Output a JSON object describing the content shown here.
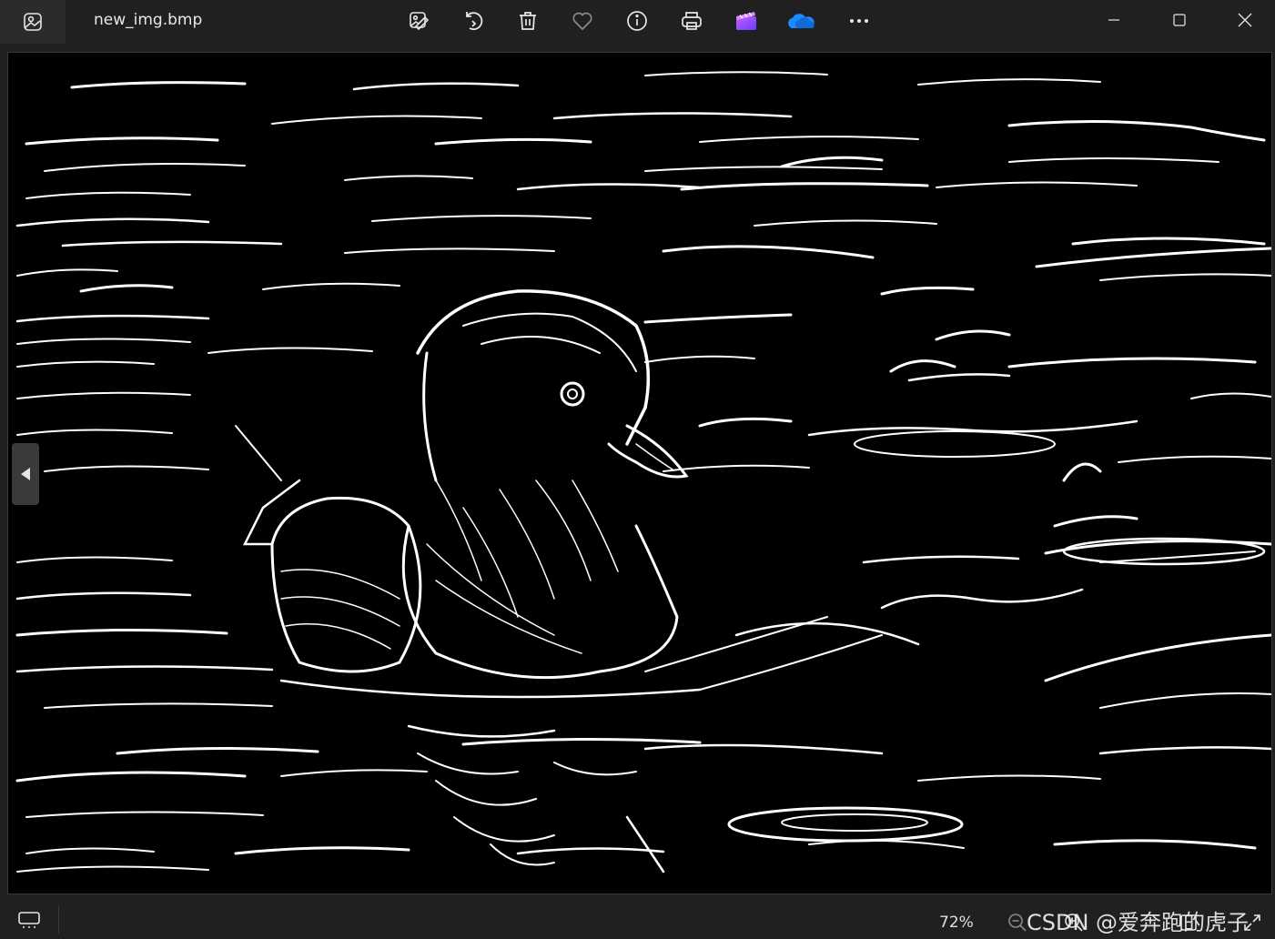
{
  "window": {
    "filename": "new_img.bmp"
  },
  "toolbar": {
    "icons": [
      "edit-image-icon",
      "rotate-icon",
      "delete-icon",
      "favorite-icon",
      "info-icon",
      "print-icon",
      "clipchamp-icon",
      "onedrive-icon",
      "more-icon"
    ]
  },
  "status": {
    "zoom": "72%"
  },
  "watermark": "CSDN @爱奔跑的虎子",
  "colors": {
    "background": "#202020",
    "image_bg": "#000000",
    "foreground": "#ffffff"
  }
}
